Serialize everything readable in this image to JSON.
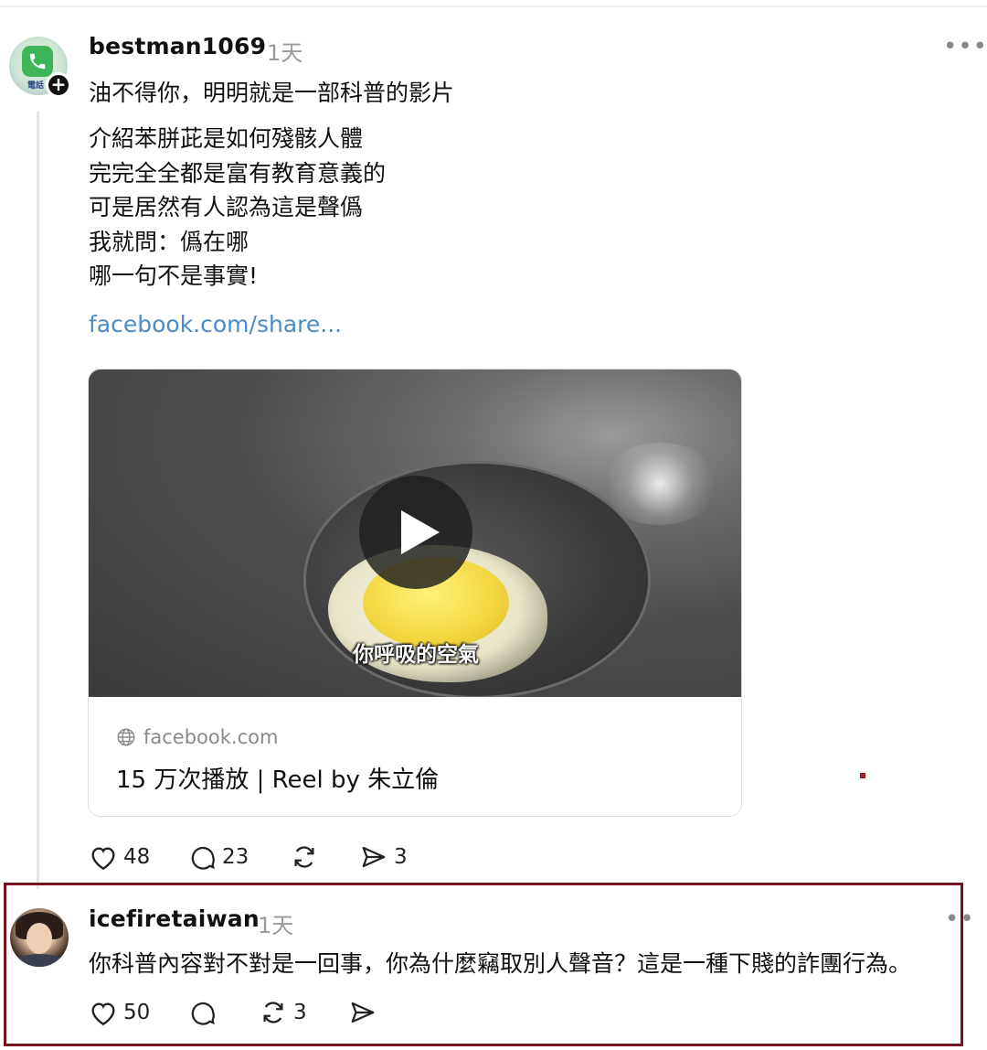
{
  "post1": {
    "username": "bestman1069",
    "time": "1天",
    "avatar_badge": "plus-icon",
    "avatar_tile_text": "電話",
    "more": "•••",
    "first_line": "油不得你，明明就是一部科普的影片",
    "body": [
      "介紹苯胼茈是如何殘骸人體",
      "完完全全都是富有教育意義的",
      "可是居然有人認為這是聲僞",
      "我就問：僞在哪",
      "哪一句不是事實!"
    ],
    "link": "facebook.com/share...",
    "card": {
      "video_caption": "你呼吸的空氣",
      "domain": "facebook.com",
      "title": "15 万次播放 | Reel by 朱立倫"
    },
    "actions": {
      "likes": "48",
      "comments": "23",
      "reposts": "",
      "shares": "3"
    }
  },
  "post2": {
    "username": "icefiretaiwan",
    "time": "1天",
    "more": "••",
    "text": "你科普內容對不對是一回事，你為什麼竊取別人聲音？這是一種下賤的詐團行為。",
    "actions": {
      "likes": "50",
      "comments": "",
      "reposts": "3",
      "shares": ""
    }
  },
  "colors": {
    "link": "#4a8bc9",
    "highlight_border": "#7a1425",
    "muted": "#9a9a9a"
  }
}
